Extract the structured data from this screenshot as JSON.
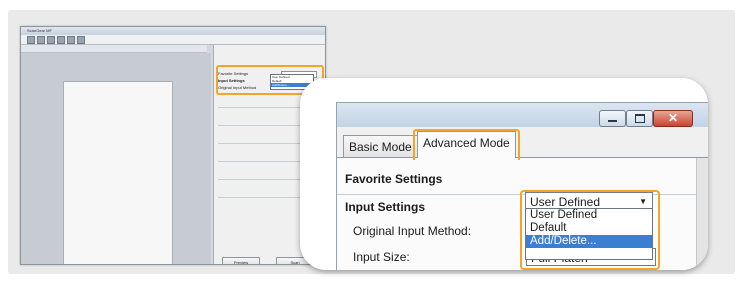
{
  "colors": {
    "highlight": "#f5a42a",
    "selection": "#3b7fd3",
    "close_button": "#c84532"
  },
  "thumbnail": {
    "title": "ScanGear MF",
    "mini_favorite_label": "Favorite Settings",
    "mini_input_label": "Input Settings",
    "mini_method_label": "Original Input Method",
    "mini_dd_items": [
      "User Defined",
      "Default",
      "Add/Delete..."
    ],
    "mini_button_left": "Preview",
    "mini_button_right": "Scan"
  },
  "window": {
    "controls": {
      "minimize_icon": "minimize-icon",
      "maximize_icon": "maximize-icon",
      "close_icon": "close-icon"
    }
  },
  "tabs": {
    "basic": "Basic Mode",
    "advanced": "Advanced Mode"
  },
  "settings": {
    "favorite_label": "Favorite Settings",
    "favorite_value": "User Defined",
    "favorite_options": [
      "User Defined",
      "Default",
      "Add/Delete..."
    ],
    "favorite_selected_option": "Add/Delete...",
    "input_heading": "Input Settings",
    "input_method_label": "Original Input Method:",
    "input_size_label": "Input Size:",
    "input_size_value": "Full Platen"
  }
}
